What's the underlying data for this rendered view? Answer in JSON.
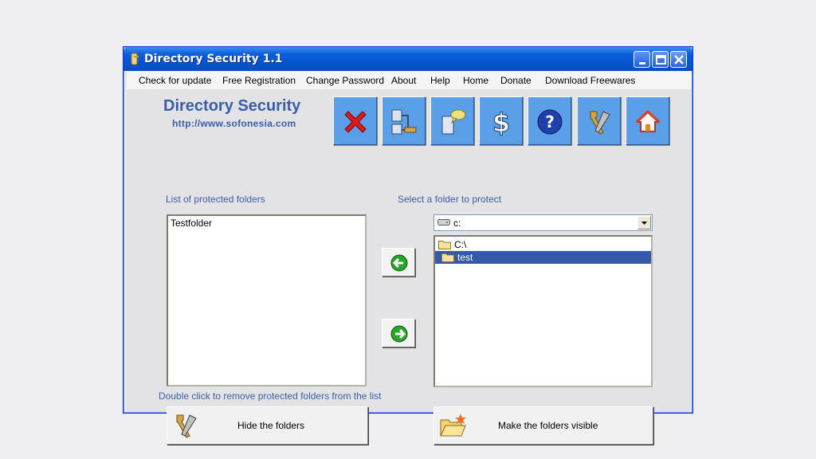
{
  "window": {
    "title": "Directory Security 1.1"
  },
  "menu": [
    "Check for update",
    "Free Registration",
    "Change Password",
    "About",
    "Help",
    "Home",
    "Donate",
    "Download Freewares"
  ],
  "brand": {
    "title": "Directory Security",
    "url": "http://www.sofonesia.com"
  },
  "toolbar": {
    "buttons": [
      "close-x-icon",
      "network-lock-icon",
      "computer-chat-icon",
      "dollar-icon",
      "help-icon",
      "tools-icon",
      "home-icon"
    ]
  },
  "left_panel": {
    "label": "List of protected folders",
    "items": [
      "Testfolder"
    ],
    "hint": "Double click to remove protected  folders from the list",
    "hide_button": "Hide the folders"
  },
  "right_panel": {
    "label": "Select a folder to protect",
    "drive": "c:",
    "tree": [
      "C:\\",
      "test"
    ],
    "selected": "test",
    "visible_button": "Make the folders visible"
  },
  "colors": {
    "accent": "#3a5da8",
    "toolbar_button": "#5aa0e8",
    "selection": "#3559a8"
  }
}
